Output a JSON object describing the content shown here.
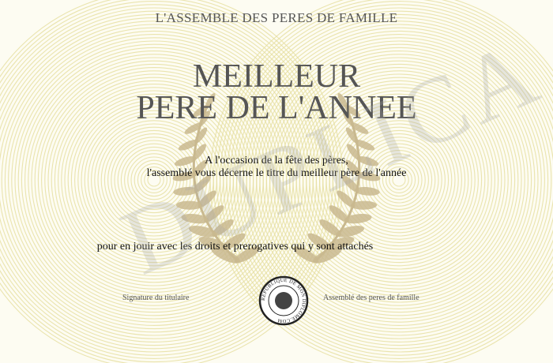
{
  "header": "L'ASSEMBLE DES PERES DE FAMILLE",
  "title_line1": "MEILLEUR",
  "title_line2": "PERE DE L'ANNEE",
  "body_line1": "A l'occasion de la fête des pères,",
  "body_line2": "l'assemblé vous décerne le titre du meilleur père de l'année",
  "body_line3": "pour en jouir avec les droits et prerogatives qui y sont attachés",
  "signature_left": "Signature du titulaire",
  "signature_right": "Assemblé des peres de famille",
  "seal_text": "REPUBLIQUE DE MON DIPLOME.COM",
  "watermark": "DUPLICA",
  "icons": [
    "laurel-wreath-icon",
    "seal-icon"
  ],
  "colors": {
    "guilloche": "#e6dfa2",
    "laurel": "#c9b98f",
    "text": "#333333"
  }
}
